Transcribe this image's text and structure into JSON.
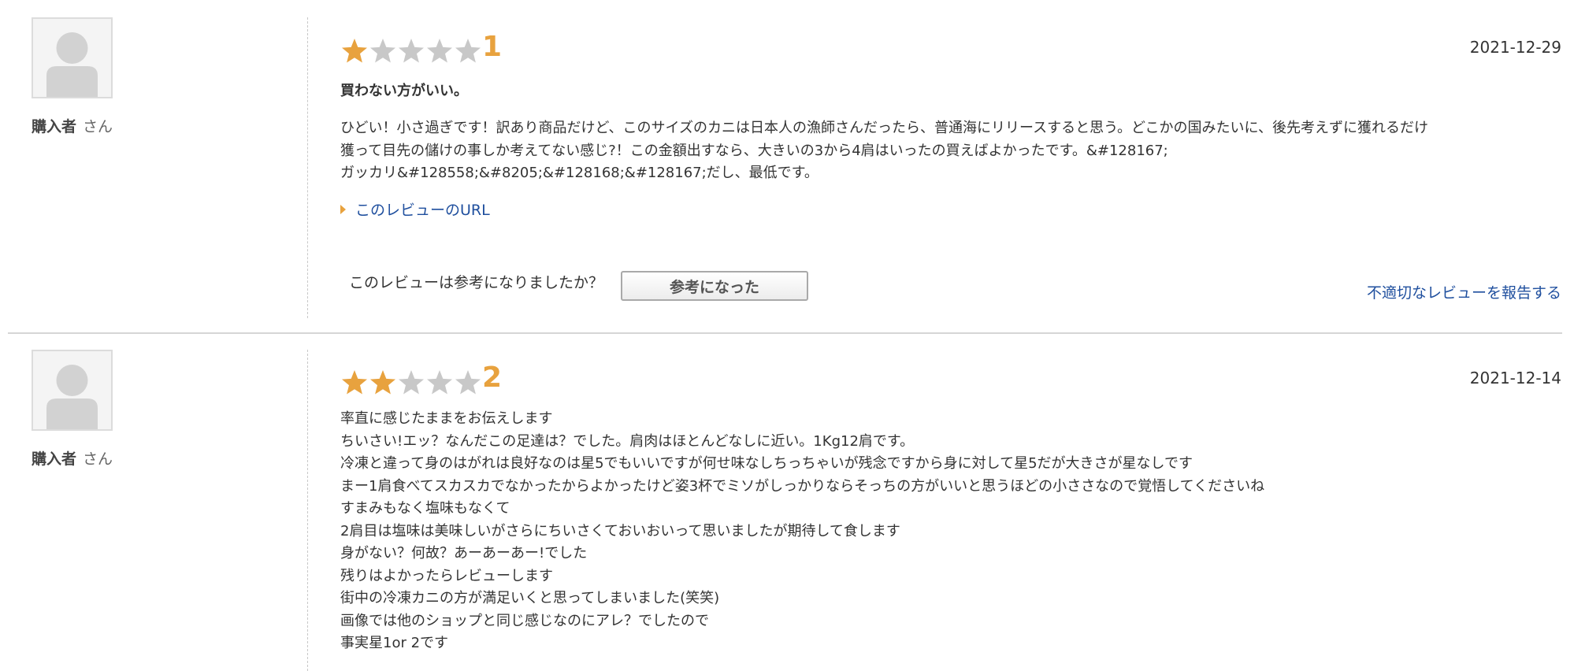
{
  "colors": {
    "star_filled": "#e8a23e",
    "star_empty": "#c8c8c8",
    "link": "#1f4f9e",
    "divider": "#d6d6d6"
  },
  "reviews": [
    {
      "reviewer": {
        "name": "購入者",
        "suffix": "さん"
      },
      "rating": 1,
      "rating_label": "1",
      "date": "2021-12-29",
      "title": "買わない方がいい。",
      "body_lines": [
        "ひどい！小さ過ぎです！訳あり商品だけど、このサイズのカニは日本人の漁師さんだったら、普通海にリリースすると思う。どこかの国みたいに、後先考えずに獲れるだけ",
        "獲って目先の儲けの事しか考えてない感じ?！この金額出すなら、大きいの3から4肩はいったの買えばよかったです。&#128167;",
        "ガッカリ&#128558;&#8205;&#128168;&#128167;だし、最低です。"
      ],
      "url_link": "このレビューのURL",
      "helpful_question": "このレビューは参考になりましたか？",
      "helpful_button": "参考になった",
      "report_link": "不適切なレビューを報告する"
    },
    {
      "reviewer": {
        "name": "購入者",
        "suffix": "さん"
      },
      "rating": 2,
      "rating_label": "2",
      "date": "2021-12-14",
      "body_lines": [
        "率直に感じたままをお伝えします",
        "ちいさい!エッ？なんだこの足達は？でした。肩肉はほとんどなしに近い。1Kg12肩です。",
        "冷凍と違って身のはがれは良好なのは星5でもいいですが何せ味なしちっちゃいが残念ですから身に対して星5だが大きさが星なしです",
        "まー1肩食べてスカスカでなかったからよかったけど姿3杯でミソがしっかりならそっちの方がいいと思うほどの小ささなので覚悟してくださいね",
        "すまみもなく塩味もなくて",
        "2肩目は塩味は美味しいがさらにちいさくておいおいって思いましたが期待して食します",
        "身がない？何故？あーあーあー!でした",
        "残りはよかったらレビューします",
        "街中の冷凍カニの方が満足いくと思ってしまいました(笑笑)",
        "画像では他のショップと同じ感じなのにアレ？でしたので",
        "事実星1or 2です"
      ]
    }
  ]
}
